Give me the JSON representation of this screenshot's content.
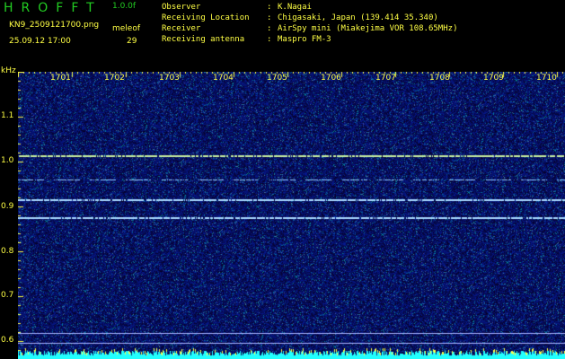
{
  "app": {
    "title": "HROFFT",
    "version": "1.0.0f"
  },
  "file": {
    "name": "KN9_2509121700.png",
    "datetime": "25.09.12 17:00"
  },
  "mode": {
    "label": "meleof",
    "count": "29"
  },
  "meta": [
    {
      "label": "Observer",
      "value": "K.Nagai"
    },
    {
      "label": "Receiving Location",
      "value": "Chigasaki, Japan (139.414 35.340)"
    },
    {
      "label": "Receiver",
      "value": "AirSpy mini (Miakejima VOR 108.65MHz)"
    },
    {
      "label": "Receiving antenna",
      "value": "Maspro FM-3"
    }
  ],
  "axes": {
    "y_unit": "kHz",
    "y_ticks": [
      "1.1",
      "1.0",
      "0.9",
      "0.8",
      "0.7",
      "0.6"
    ],
    "x_ticks": [
      "1701",
      "1702",
      "1703",
      "1704",
      "1705",
      "1706",
      "1707",
      "1708",
      "1709",
      "1710"
    ]
  },
  "colors": {
    "background": "#000000",
    "text": "#ffff44",
    "title": "#22cc22",
    "noise": "#1a2a9a",
    "signal": "#9fd0ff",
    "baseline": "#22ffff"
  }
}
